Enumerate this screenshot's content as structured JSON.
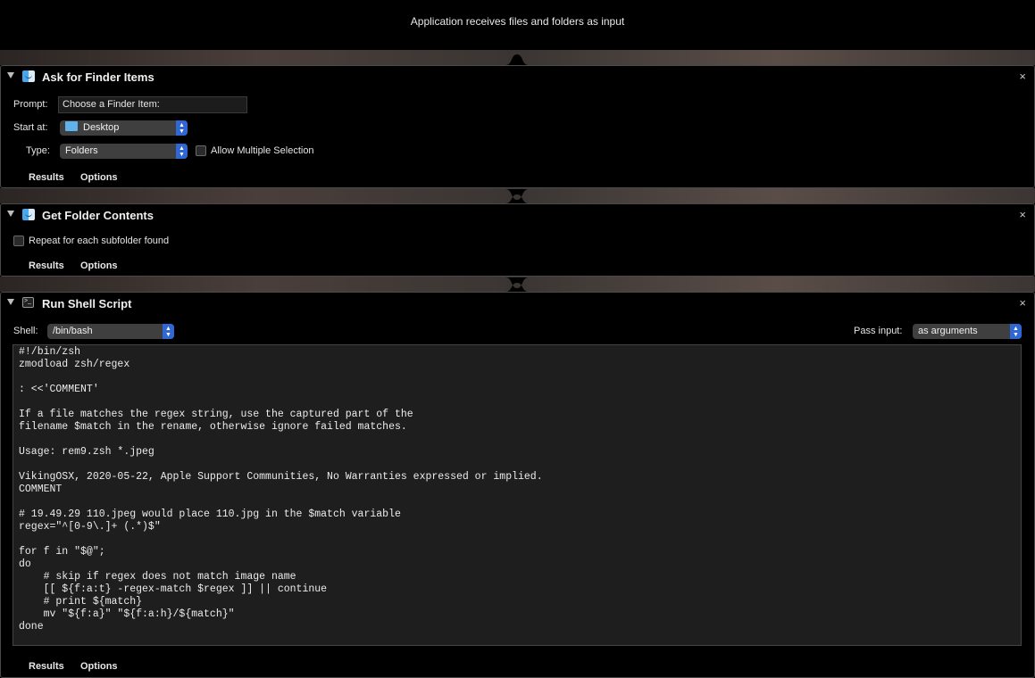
{
  "header": {
    "text": "Application receives files and folders as input"
  },
  "actions": [
    {
      "title": "Ask for Finder Items",
      "icon": "finder-icon",
      "prompt_label": "Prompt:",
      "prompt_value": "Choose a Finder Item:",
      "start_label": "Start at:",
      "start_value": "Desktop",
      "type_label": "Type:",
      "type_value": "Folders",
      "allow_multiple_label": "Allow Multiple Selection",
      "allow_multiple_checked": false,
      "results_label": "Results",
      "options_label": "Options"
    },
    {
      "title": "Get Folder Contents",
      "icon": "finder-icon",
      "repeat_label": "Repeat for each subfolder found",
      "repeat_checked": false,
      "results_label": "Results",
      "options_label": "Options"
    },
    {
      "title": "Run Shell Script",
      "icon": "terminal-icon",
      "shell_label": "Shell:",
      "shell_value": "/bin/bash",
      "pass_input_label": "Pass input:",
      "pass_input_value": "as arguments",
      "script": "#!/bin/zsh\nzmodload zsh/regex\n\n: <<'COMMENT'\n\nIf a file matches the regex string, use the captured part of the\nfilename $match in the rename, otherwise ignore failed matches.\n\nUsage: rem9.zsh *.jpeg\n\nVikingOSX, 2020-05-22, Apple Support Communities, No Warranties expressed or implied.\nCOMMENT\n\n# 19.49.29 110.jpeg would place 110.jpg in the $match variable\nregex=\"^[0-9\\.]+ (.*)$\"\n\nfor f in \"$@\";\ndo\n    # skip if regex does not match image name\n    [[ ${f:a:t} -regex-match $regex ]] || continue\n    # print ${match}\n    mv \"${f:a}\" \"${f:a:h}/${match}\"\ndone",
      "results_label": "Results",
      "options_label": "Options"
    }
  ],
  "close_glyph": "×"
}
